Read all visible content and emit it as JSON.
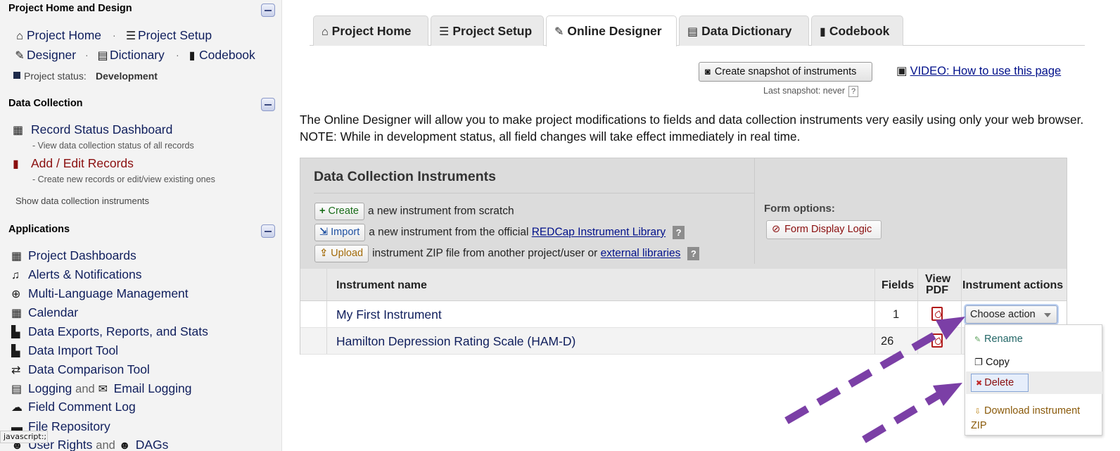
{
  "sidebar": {
    "section_project": "Project Home and Design",
    "project_home": "Project Home",
    "project_setup": "Project Setup",
    "designer": "Designer",
    "dictionary": "Dictionary",
    "codebook": "Codebook",
    "status_label": "Project status:",
    "status_value": "Development",
    "section_data": "Data Collection",
    "record_status": "Record Status Dashboard",
    "record_status_desc": "- View data collection status of all records",
    "add_edit": "Add / Edit Records",
    "add_edit_desc": "- Create new records or edit/view existing ones",
    "show_instruments": "Show data collection instruments",
    "section_apps": "Applications",
    "apps": [
      {
        "label": "Project Dashboards"
      },
      {
        "label": "Alerts & Notifications"
      },
      {
        "label": "Multi-Language Management"
      },
      {
        "label": "Calendar"
      },
      {
        "label": "Data Exports, Reports, and Stats"
      },
      {
        "label": "Data Import Tool"
      },
      {
        "label": "Data Comparison Tool"
      },
      {
        "label": "Logging",
        "mid": "and",
        "second": "Email Logging"
      },
      {
        "label": "Field Comment Log"
      },
      {
        "label": "File Repository"
      },
      {
        "label": "User Rights",
        "mid": "and",
        "second": "DAGs"
      }
    ]
  },
  "status_bar": "javascript:;",
  "tabs": [
    {
      "label": "Project Home",
      "icon": "house-icon"
    },
    {
      "label": "Project Setup",
      "icon": "checklist-icon"
    },
    {
      "label": "Online Designer",
      "icon": "edit-icon"
    },
    {
      "label": "Data Dictionary",
      "icon": "excel-icon"
    },
    {
      "label": "Codebook",
      "icon": "book-icon"
    }
  ],
  "snapshot": {
    "button": "Create snapshot of instruments",
    "last": "Last snapshot: never",
    "help": "?"
  },
  "video_link": "VIDEO: How to use this page",
  "intro": "The Online Designer will allow you to make project modifications to fields and data collection instruments very easily using only your web browser. NOTE: While in development status, all field changes will take effect immediately in real time.",
  "dci": {
    "title": "Data Collection Instruments",
    "create_btn": "Create",
    "create_text": "a new instrument from scratch",
    "import_btn": "Import",
    "import_text": "a new instrument from the official",
    "import_link": "REDCap Instrument Library",
    "upload_btn": "Upload",
    "upload_text": "instrument ZIP file from another project/user or",
    "upload_link": "external libraries",
    "help": "?",
    "form_options": "Form options:",
    "form_display_logic": "Form Display Logic"
  },
  "table": {
    "headers": {
      "name": "Instrument name",
      "fields": "Fields",
      "pdf_line1": "View",
      "pdf_line2": "PDF",
      "actions": "Instrument actions"
    },
    "rows": [
      {
        "name": "My First Instrument",
        "fields": "1"
      },
      {
        "name": "Hamilton Depression Rating Scale (HAM-D)",
        "fields": "26"
      }
    ]
  },
  "action_select": "Choose action",
  "action_menu": {
    "rename": "Rename",
    "copy": "Copy",
    "delete": "Delete",
    "download_line1": "Download instrument",
    "download_line2": "ZIP"
  },
  "colors": {
    "link": "#0f1e5c",
    "delete": "#8a0e0e",
    "annotation_arrow": "#7b3fa6"
  }
}
